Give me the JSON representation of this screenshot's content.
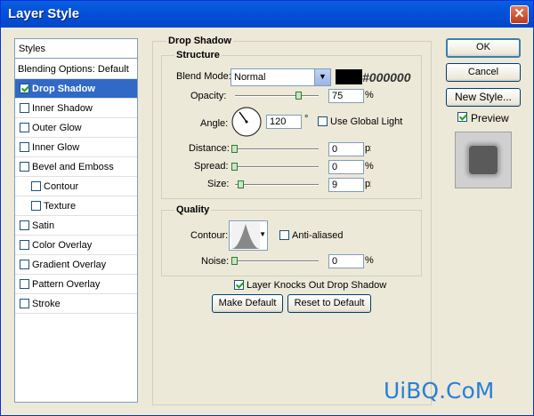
{
  "window": {
    "title": "Layer Style"
  },
  "styles_list": {
    "header": "Styles",
    "blending": "Blending Options: Default",
    "items": [
      {
        "label": "Drop Shadow",
        "checked": true,
        "selected": true,
        "indent": false
      },
      {
        "label": "Inner Shadow",
        "checked": false,
        "selected": false,
        "indent": false
      },
      {
        "label": "Outer Glow",
        "checked": false,
        "selected": false,
        "indent": false
      },
      {
        "label": "Inner Glow",
        "checked": false,
        "selected": false,
        "indent": false
      },
      {
        "label": "Bevel and Emboss",
        "checked": false,
        "selected": false,
        "indent": false
      },
      {
        "label": "Contour",
        "checked": false,
        "selected": false,
        "indent": true
      },
      {
        "label": "Texture",
        "checked": false,
        "selected": false,
        "indent": true
      },
      {
        "label": "Satin",
        "checked": false,
        "selected": false,
        "indent": false
      },
      {
        "label": "Color Overlay",
        "checked": false,
        "selected": false,
        "indent": false
      },
      {
        "label": "Gradient Overlay",
        "checked": false,
        "selected": false,
        "indent": false
      },
      {
        "label": "Pattern Overlay",
        "checked": false,
        "selected": false,
        "indent": false
      },
      {
        "label": "Stroke",
        "checked": false,
        "selected": false,
        "indent": false
      }
    ]
  },
  "drop_shadow": {
    "title": "Drop Shadow",
    "structure": {
      "title": "Structure",
      "blend_mode_label": "Blend Mode:",
      "blend_mode_value": "Normal",
      "color_hex": "#000000",
      "color_label": "#000000",
      "opacity_label": "Opacity:",
      "opacity_value": "75",
      "opacity_unit": "%",
      "opacity_fraction": 0.75,
      "angle_label": "Angle:",
      "angle_value": "120",
      "angle_unit": "°",
      "use_global_light": "Use Global Light",
      "use_global_light_checked": false,
      "distance_label": "Distance:",
      "distance_value": "0",
      "distance_unit": "px",
      "spread_label": "Spread:",
      "spread_value": "0",
      "spread_unit": "%",
      "size_label": "Size:",
      "size_value": "9",
      "size_unit": "px"
    },
    "quality": {
      "title": "Quality",
      "contour_label": "Contour:",
      "anti_aliased": "Anti-aliased",
      "anti_aliased_checked": false,
      "noise_label": "Noise:",
      "noise_value": "0",
      "noise_unit": "%"
    },
    "knocks_out": "Layer Knocks Out Drop Shadow",
    "knocks_out_checked": true,
    "make_default": "Make Default",
    "reset_default": "Reset to Default"
  },
  "right_panel": {
    "ok": "OK",
    "cancel": "Cancel",
    "new_style": "New Style...",
    "preview": "Preview",
    "preview_checked": true
  },
  "watermark": "UiBQ.CoM"
}
